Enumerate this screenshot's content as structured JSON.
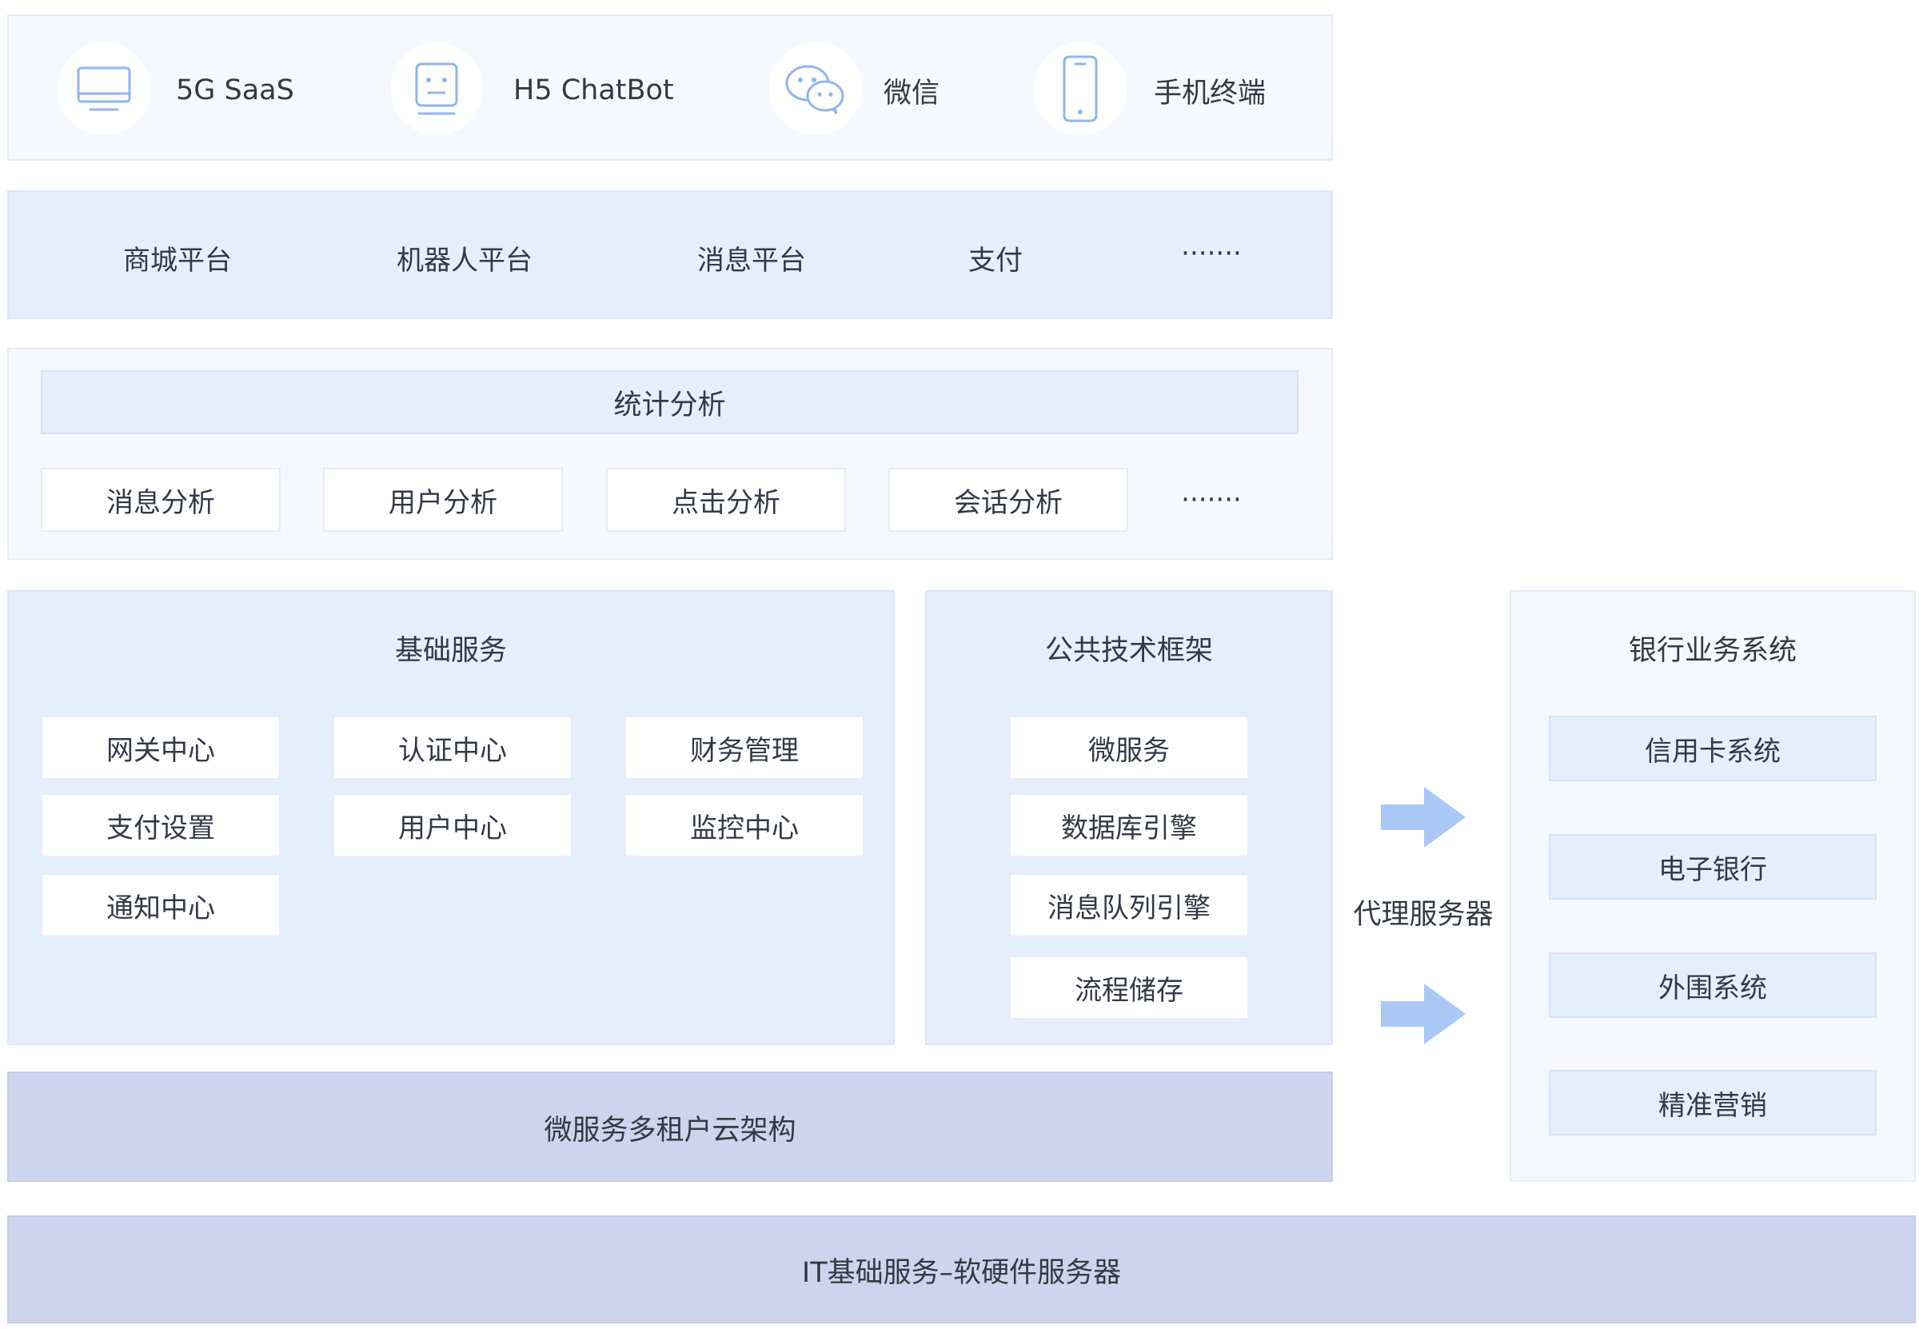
{
  "channels": [
    {
      "label": "5G SaaS",
      "icon": "monitor-icon"
    },
    {
      "label": "H5 ChatBot",
      "icon": "robot-icon"
    },
    {
      "label": "微信",
      "icon": "wechat-icon"
    },
    {
      "label": "手机终端",
      "icon": "phone-icon"
    }
  ],
  "platforms": [
    "商城平台",
    "机器人平台",
    "消息平台",
    "支付",
    "·······"
  ],
  "analytics": {
    "title": "统计分析",
    "items": [
      "消息分析",
      "用户分析",
      "点击分析",
      "会话分析"
    ],
    "more": "·······"
  },
  "basic_services": {
    "title": "基础服务",
    "items": [
      "网关中心",
      "认证中心",
      "财务管理",
      "支付设置",
      "用户中心",
      "监控中心",
      "通知中心"
    ]
  },
  "tech_framework": {
    "title": "公共技术框架",
    "items": [
      "微服务",
      "数据库引擎",
      "消息队列引擎",
      "流程储存"
    ]
  },
  "proxy": {
    "label": "代理服务器"
  },
  "bank_systems": {
    "title": "银行业务系统",
    "items": [
      "信用卡系统",
      "电子银行",
      "外围系统",
      "精准营销"
    ]
  },
  "cloud_layer": "微服务多租户云架构",
  "infra_layer": "IT基础服务–软硬件服务器",
  "colors": {
    "icon_blue": "#8fb6ee",
    "arrow_blue": "#a9c8f6",
    "panel_blue": "#e4eefd",
    "panel_light": "#f5f8fe",
    "panel_purple": "#cdd4ee"
  }
}
